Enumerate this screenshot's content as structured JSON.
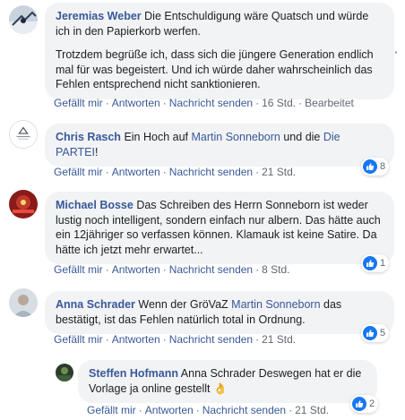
{
  "comments": [
    {
      "author": "Jeremias Weber",
      "text1": "Die Entschuldigung wäre Quatsch und würde ich in den Papierkorb werfen.",
      "text2": "Trotzdem begrüße ich, dass sich die jüngere Generation endlich mal für was begeistert. Und ich würde daher wahrscheinlich das Fehlen entsprechend nicht sanktionieren.",
      "time": "16 Std.",
      "edited": "Bearbeitet"
    },
    {
      "author": "Chris Rasch",
      "text_a": "Ein Hoch auf",
      "mention1": "Martin Sonneborn",
      "text_b": "und die",
      "mention2": "Die PARTEI",
      "text_c": "!",
      "time": "21 Std.",
      "reactions": "8"
    },
    {
      "author": "Michael Bosse",
      "text": "Das Schreiben des Herrn Sonneborn ist weder lustig noch intelligent, sondern einfach nur albern. Das hätte auch ein 12jähriger so verfassen können. Klamauk ist keine Satire. Da hätte ich jetzt mehr erwartet...",
      "time": "8 Std.",
      "reactions": "1"
    },
    {
      "author": "Anna Schrader",
      "text_a": "Wenn der GröVaZ",
      "mention1": "Martin Sonneborn",
      "text_b": "das bestätigt, ist das Fehlen natürlich total in Ordnung.",
      "time": "21 Std.",
      "reactions": "5"
    },
    {
      "author": "Steffen Hofmann",
      "text": "Anna Schrader Deswegen hat er die Vorlage ja online gestellt",
      "emoji": "👌",
      "time": "21 Std.",
      "reactions": "2"
    }
  ],
  "actions": {
    "like": "Gefällt mir",
    "reply": "Antworten",
    "message": "Nachricht senden",
    "separator": "·"
  },
  "options_icon": "more-options-icon",
  "colors": {
    "author": "#385898",
    "bubble": "#f2f3f5",
    "meta": "#606770",
    "like_blue": "#1877f2"
  }
}
